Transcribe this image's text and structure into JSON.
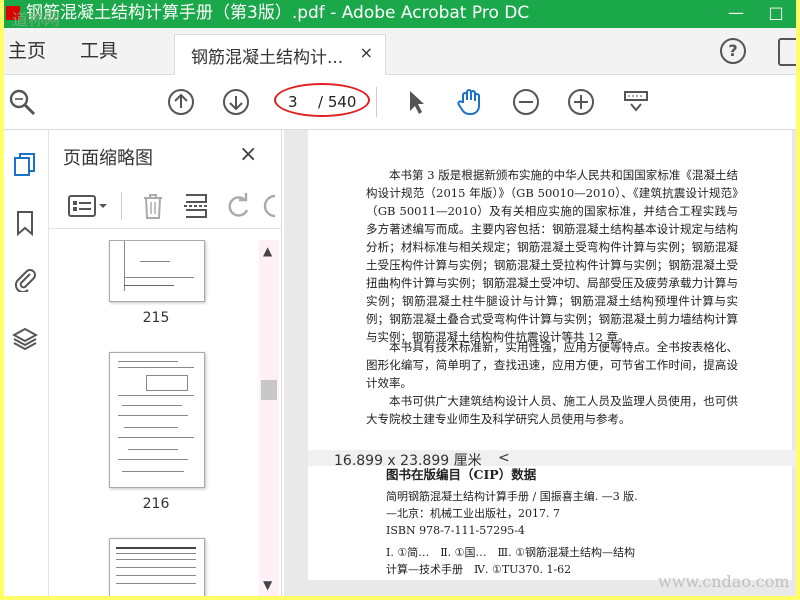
{
  "window": {
    "title": "钢筋混凝土结构计算手册（第3版）.pdf - Adobe Acrobat Pro DC",
    "minimize": "—",
    "maximize": "□"
  },
  "menu": {
    "home": "主页",
    "tools": "工具"
  },
  "tab": {
    "label": "钢筋混凝土结构计...",
    "close": "×"
  },
  "help": "?",
  "pagenav": {
    "current": "3",
    "total": "/ 540"
  },
  "panel": {
    "title": "页面缩略图",
    "close": "×",
    "thumbnails": [
      {
        "page": "215"
      },
      {
        "page": "216"
      }
    ]
  },
  "document": {
    "paragraphs": [
      "本书第 3 版是根据新颁布实施的中华人民共和国国家标准《混凝土结构设计规范（2015 年版）》（GB 50010—2010）、《建筑抗震设计规范》（GB 50011—2010）及有关相应实施的国家标准，并结合工程实践与多方著述编写而成。主要内容包括：钢筋混凝土结构基本设计规定与结构分析；材料标准与相关规定；钢筋混凝土受弯构件计算与实例；钢筋混凝土受压构件计算与实例；钢筋混凝土受拉构件计算与实例；钢筋混凝土受扭曲构件计算与实例；钢筋混凝土受冲切、局部受压及疲劳承载力计算与实例；钢筋混凝土柱牛腿设计与计算；钢筋混凝土结构预埋件计算与实例；钢筋混凝土叠合式受弯构件计算与实例；钢筋混凝土剪力墙结构计算与实例；钢筋混凝土结构构件抗震设计等共 12 章。",
      "本书具有技术标准新，实用性强，应用方便等特点。全书按表格化、图形化编写，简单明了，查找迅速，应用方便，可节省工作时间，提高设计效率。",
      "本书可供广大建筑结构设计人员、施工人员及监理人员使用，也可供大专院校土建专业师生及科学研究人员使用与参考。"
    ],
    "cip_heading": "图书在版编目（CIP）数据",
    "cip_lines": [
      "简明钢筋混凝土结构计算手册 / 国振喜主编. —3 版.",
      "—北京：机械工业出版社，2017. 7",
      "ISBN 978-7-111-57295-4",
      "Ⅰ. ①简…　Ⅱ. ①国…　Ⅲ. ①钢筋混凝土结构—结构",
      "计算—技术手册　Ⅳ. ①TU370. 1-62"
    ]
  },
  "status": {
    "dimensions": "16.899 x 23.899 厘米",
    "arrow": "<"
  },
  "watermarks": {
    "top_left": "道称网",
    "bottom_right": "www.cndao.com"
  },
  "colors": {
    "title_bar": "#1aa84a",
    "annotation_oval": "#e02020",
    "accent_icon": "#1a73c8"
  }
}
